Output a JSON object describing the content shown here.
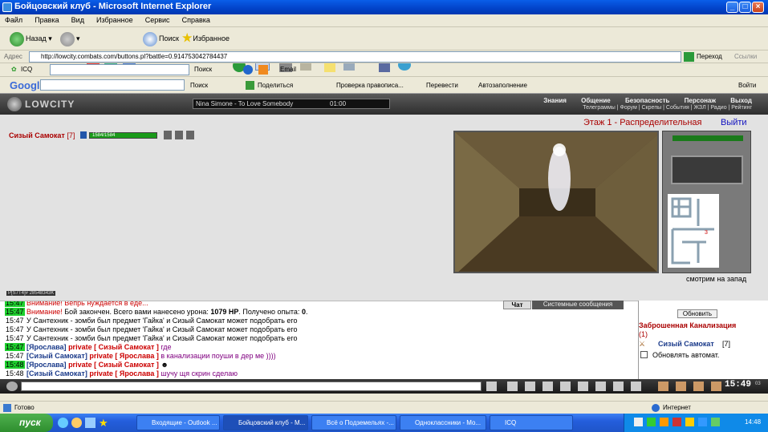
{
  "window": {
    "title": "Бойцовский клуб - Microsoft Internet Explorer"
  },
  "menu": [
    "Файл",
    "Правка",
    "Вид",
    "Избранное",
    "Сервис",
    "Справка"
  ],
  "toolbar": {
    "back": "Назад",
    "search": "Поиск",
    "favorites": "Избранное"
  },
  "address": {
    "label": "Адрес",
    "url": "http://lowcity.combats.com/buttons.pl?battle=0.914753042784437",
    "go": "Переход",
    "links": "Ссылки"
  },
  "icqbar": {
    "icq": "ICQ",
    "search": "Поиск",
    "email": "Email"
  },
  "googlebar": {
    "logo": "Google",
    "search": "Поиск",
    "share": "Поделиться",
    "spell": "Проверка правописа...",
    "translate": "Перевести",
    "autofill": "Автозаполнение",
    "login": "Войти"
  },
  "game": {
    "logo": "LOWCITY",
    "track": "Nina Simone - To Love Somebody",
    "track_time": "01:00",
    "nav_primary": [
      "Знания",
      "Общение",
      "Безопасность",
      "Персонаж",
      "Выход"
    ],
    "nav_secondary": "Телеграммы | Форум | Скрепы | События | ЖЗЛ | Радио | Рейтинг",
    "location": "Этаж 1 - Распределительная",
    "exit": "Выйти",
    "player_name": "Сизый Самокат",
    "player_level": "[7]",
    "hp_text": "1584/1584",
    "facing": "смотрим на запад",
    "battle_id": "P[S7T4]# 28548343K"
  },
  "chat": {
    "tabs": [
      "Чат",
      "Системные сообщения"
    ],
    "lines": [
      {
        "time": "15:47",
        "text": "Внимание! Вепрь нуждается в еде..."
      },
      {
        "time": "15:47",
        "prefix": "Внимание!",
        "text": " Бой закончен. Всего вами нанесено урона: ",
        "bold1": "1079 HP",
        "text2": ". Получено опыта: ",
        "bold2": "0",
        "text3": "."
      },
      {
        "time": "15:47",
        "text": "У Сантехник - зомби был предмет 'Гайка' и Сизый Самокат может подобрать его"
      },
      {
        "time": "15:47",
        "text": "У Сантехник - зомби был предмет 'Гайка' и Сизый Самокат может подобрать его"
      },
      {
        "time": "15:47",
        "text": "У Сантехник - зомби был предмет 'Гайка' и Сизый Самокат может подобрать его"
      },
      {
        "time": "15:47",
        "from": "[Ярослава]",
        "priv": "private [ Сизый Самокат ]",
        "msg": "где"
      },
      {
        "time": "15:47",
        "from": "[Сизый Самокат]",
        "priv": "private [ Ярослава ]",
        "msg": "в канализации поуши в дер ме ))))"
      },
      {
        "time": "15:48",
        "from": "[Ярослава]",
        "priv": "private [ Сизый Самокат ]",
        "msg": "☻"
      },
      {
        "time": "15:48",
        "from": "[Сизый Самокат]",
        "priv": "private [ Ярослава ]",
        "msg": "шучу щя скрин сделаю"
      }
    ]
  },
  "right_panel": {
    "refresh": "Обновить",
    "location_title": "Заброшенная Канализация",
    "count": "(1)",
    "member": "Сизый Самокат",
    "member_level": "[7]",
    "auto_refresh": "Обновлять автомат."
  },
  "clock": "15:49",
  "clock_sub": "03",
  "status": {
    "left": "Готово",
    "right": "Интернет"
  },
  "taskbar": {
    "start": "пуск",
    "tasks": [
      "Входящие - Outlook ...",
      "Бойцовский клуб - М...",
      "Всё о Подземельях -...",
      "Одноклассники - Мо...",
      "ICQ"
    ],
    "lang": "RL",
    "time": "14:48"
  },
  "colors": {
    "title_blue": "#0242c8",
    "chat_private": "#cc0000",
    "hp_bar": "#1a9a1a",
    "location_red": "#aa0000",
    "exit_blue": "#1010c0"
  }
}
